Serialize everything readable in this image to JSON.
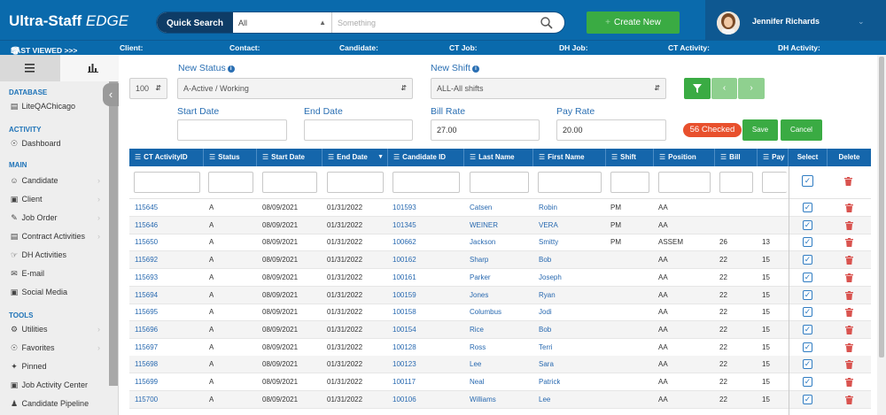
{
  "app": {
    "logo_bold_a": "Ultra-",
    "logo_bold_b": "Staff",
    "logo_italic": " EDGE"
  },
  "header": {
    "quick_search_label": "Quick Search",
    "search_scope": "All",
    "search_placeholder": "Something",
    "create_new_label": "Create New",
    "user_name": "Jennifer Richards"
  },
  "last_viewed": {
    "title": "LAST VIEWED >>>",
    "client": "Client:",
    "contact": "Contact:",
    "candidate": "Candidate:",
    "ct_job": "CT Job:",
    "dh_job": "DH Job:",
    "ct_activity": "CT Activity:",
    "dh_activity": "DH Activity:"
  },
  "sidebar": {
    "database_heading": "DATABASE",
    "database_name": "LiteQAChicago",
    "activity_heading": "ACTIVITY",
    "dashboard": "Dashboard",
    "main_heading": "MAIN",
    "items_main": [
      "Candidate",
      "Client",
      "Job Order",
      "Contract Activities",
      "DH Activities",
      "E-mail",
      "Social Media"
    ],
    "tools_heading": "TOOLS",
    "items_tools": [
      "Utilities",
      "Favorites",
      "Pinned",
      "Job Activity Center",
      "Candidate Pipeline"
    ]
  },
  "filters": {
    "page_size": "100",
    "new_status_label": "New Status",
    "new_status_value": "A-Active / Working",
    "new_shift_label": "New Shift",
    "new_shift_value": "ALL-All shifts",
    "start_date_label": "Start Date",
    "end_date_label": "End Date",
    "bill_rate_label": "Bill Rate",
    "bill_rate_value": "27.00",
    "pay_rate_label": "Pay Rate",
    "pay_rate_value": "20.00",
    "checked_badge": "56 Checked",
    "save_label": "Save",
    "cancel_label": "Cancel"
  },
  "table": {
    "columns": [
      "CT ActivityID",
      "Status",
      "Start Date",
      "End Date",
      "Candidate ID",
      "Last Name",
      "First Name",
      "Shift",
      "Position",
      "Bill",
      "Pay",
      "Select",
      "Delete"
    ],
    "rows": [
      {
        "id": "115645",
        "status": "A",
        "start": "08/09/2021",
        "end": "01/31/2022",
        "cand": "101593",
        "last": "Catsen",
        "first": "Robin",
        "shift": "PM",
        "pos": "AA",
        "bill": "",
        "pay": ""
      },
      {
        "id": "115646",
        "status": "A",
        "start": "08/09/2021",
        "end": "01/31/2022",
        "cand": "101345",
        "last": "WEINER",
        "first": "VERA",
        "shift": "PM",
        "pos": "AA",
        "bill": "",
        "pay": ""
      },
      {
        "id": "115650",
        "status": "A",
        "start": "08/09/2021",
        "end": "01/31/2022",
        "cand": "100662",
        "last": "Jackson",
        "first": "Smitty",
        "shift": "PM",
        "pos": "ASSEM",
        "bill": "26",
        "pay": "13"
      },
      {
        "id": "115692",
        "status": "A",
        "start": "08/09/2021",
        "end": "01/31/2022",
        "cand": "100162",
        "last": "Sharp",
        "first": "Bob",
        "shift": "",
        "pos": "AA",
        "bill": "22",
        "pay": "15"
      },
      {
        "id": "115693",
        "status": "A",
        "start": "08/09/2021",
        "end": "01/31/2022",
        "cand": "100161",
        "last": "Parker",
        "first": "Joseph",
        "shift": "",
        "pos": "AA",
        "bill": "22",
        "pay": "15"
      },
      {
        "id": "115694",
        "status": "A",
        "start": "08/09/2021",
        "end": "01/31/2022",
        "cand": "100159",
        "last": "Jones",
        "first": "Ryan",
        "shift": "",
        "pos": "AA",
        "bill": "22",
        "pay": "15"
      },
      {
        "id": "115695",
        "status": "A",
        "start": "08/09/2021",
        "end": "01/31/2022",
        "cand": "100158",
        "last": "Columbus",
        "first": "Jodi",
        "shift": "",
        "pos": "AA",
        "bill": "22",
        "pay": "15"
      },
      {
        "id": "115696",
        "status": "A",
        "start": "08/09/2021",
        "end": "01/31/2022",
        "cand": "100154",
        "last": "Rice",
        "first": "Bob",
        "shift": "",
        "pos": "AA",
        "bill": "22",
        "pay": "15"
      },
      {
        "id": "115697",
        "status": "A",
        "start": "08/09/2021",
        "end": "01/31/2022",
        "cand": "100128",
        "last": "Ross",
        "first": "Terri",
        "shift": "",
        "pos": "AA",
        "bill": "22",
        "pay": "15"
      },
      {
        "id": "115698",
        "status": "A",
        "start": "08/09/2021",
        "end": "01/31/2022",
        "cand": "100123",
        "last": "Lee",
        "first": "Sara",
        "shift": "",
        "pos": "AA",
        "bill": "22",
        "pay": "15"
      },
      {
        "id": "115699",
        "status": "A",
        "start": "08/09/2021",
        "end": "01/31/2022",
        "cand": "100117",
        "last": "Neal",
        "first": "Patrick",
        "shift": "",
        "pos": "AA",
        "bill": "22",
        "pay": "15"
      },
      {
        "id": "115700",
        "status": "A",
        "start": "08/09/2021",
        "end": "01/31/2022",
        "cand": "100106",
        "last": "Williams",
        "first": "Lee",
        "shift": "",
        "pos": "AA",
        "bill": "22",
        "pay": "15"
      }
    ]
  },
  "colors": {
    "header_blue": "#0a6aac",
    "table_header_blue": "#1566ab",
    "green": "#3aab43",
    "badge_orange": "#e8502d",
    "link_blue": "#2869b0",
    "delete_red": "#d9534f"
  }
}
